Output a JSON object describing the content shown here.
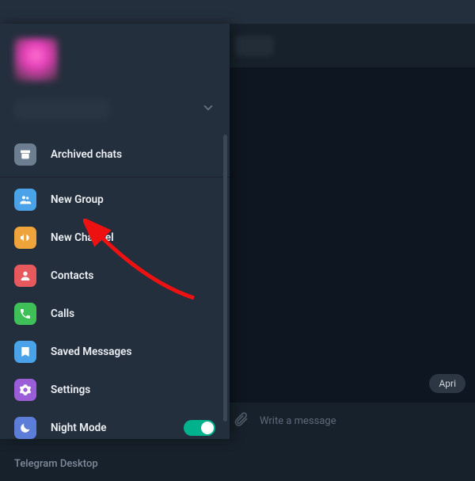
{
  "titlebar": {},
  "profile": {},
  "menu": {
    "archived": "Archived chats",
    "new_group": "New Group",
    "new_channel": "New Channel",
    "contacts": "Contacts",
    "calls": "Calls",
    "saved": "Saved Messages",
    "settings": "Settings",
    "night_mode": "Night Mode"
  },
  "footer": {
    "app_name": "Telegram Desktop"
  },
  "chat": {
    "date_label": "Apri",
    "composer_placeholder": "Write a message"
  },
  "colors": {
    "accent_teal": "#00b18e",
    "icon_gray": "#6e7e91",
    "icon_blue": "#4aa3e8",
    "icon_orange": "#efa33b",
    "icon_red": "#e8595d",
    "icon_green": "#3fbf58",
    "icon_bookmark": "#4aa3e8",
    "icon_purple": "#9b5dd8",
    "icon_indigo": "#5d7ed8"
  }
}
